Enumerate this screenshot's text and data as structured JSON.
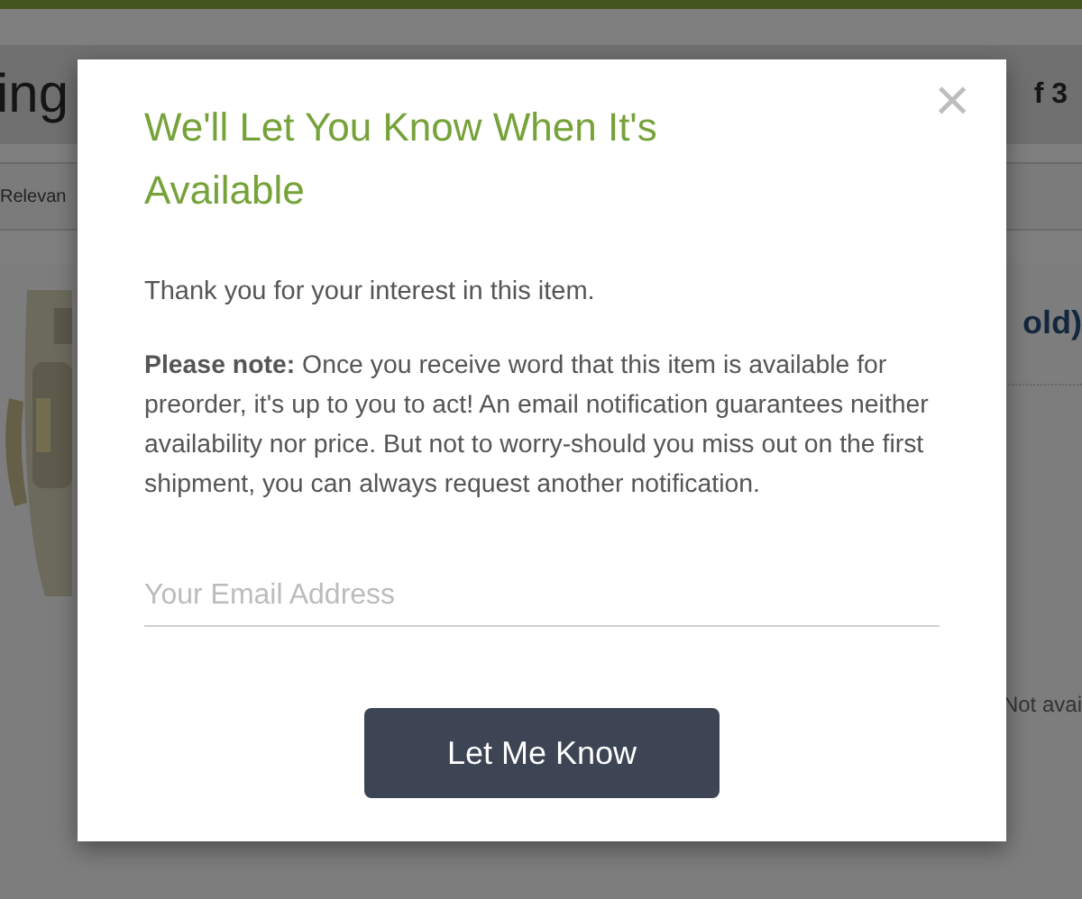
{
  "page": {
    "heading": "ing",
    "page_count": "f 3",
    "sort": "Relevan",
    "product_title": "old)",
    "availability": "Not avai"
  },
  "dialog": {
    "title": "We'll Let You Know When It's Available",
    "close": "×",
    "intro": "Thank you for your interest in this item.",
    "note": "**Please note:** Once you receive word that this item is available for preorder, it's up to you to act! An email notification guarantees neither availability nor price. But not to worry-should you miss out on the first shipment, you can always request another notification.",
    "email": {
      "placeholder": "Your Email Address"
    },
    "submit": "Let Me Know"
  }
}
